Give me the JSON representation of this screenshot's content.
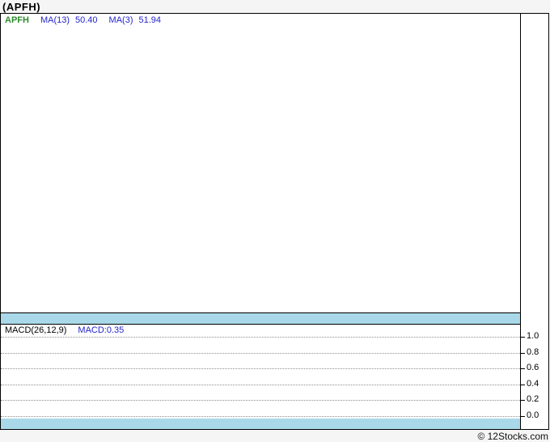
{
  "page": {
    "title": "(APFH)"
  },
  "main_chart": {
    "legend": {
      "ticker": "APFH",
      "ma13_label": "MA(13)",
      "ma13_value": "50.40",
      "ma3_label": "MA(3)",
      "ma3_value": "51.94"
    }
  },
  "macd_panel": {
    "legend_label": "MACD(26,12,9)",
    "legend_value": "MACD:0.35",
    "yticks": [
      "1.0",
      "0.8",
      "0.6",
      "0.4",
      "0.2",
      "0.0"
    ]
  },
  "footer": {
    "copyright": "© 12Stocks.com"
  },
  "colors": {
    "separator_band": "#a9d9e9",
    "ticker_green": "#2e8b2e",
    "indicator_blue": "#2323cd",
    "frame": "#000000",
    "strip_bg": "#f5f5f5",
    "grid_dotted": "#8f8f8f"
  },
  "chart_data": [
    {
      "type": "line",
      "title": "(APFH)",
      "series": [
        {
          "name": "APFH",
          "values": []
        },
        {
          "name": "MA(13)",
          "last_value": 50.4,
          "values": []
        },
        {
          "name": "MA(3)",
          "last_value": 51.94,
          "values": []
        }
      ],
      "legend_position": "top-left",
      "grid": "off",
      "note": "price pane is rendered empty - no visible data points or axis labels"
    },
    {
      "type": "line",
      "title": "MACD(26,12,9)",
      "series": [
        {
          "name": "MACD",
          "last_value": 0.35,
          "values": []
        }
      ],
      "ylim": [
        0.0,
        1.0
      ],
      "yticks": [
        1.0,
        0.8,
        0.6,
        0.4,
        0.2,
        0.0
      ],
      "grid": "dotted-horizontal",
      "legend_position": "top-left",
      "note": "indicator pane shows gridlines and axis only - no visible plotted line"
    }
  ]
}
